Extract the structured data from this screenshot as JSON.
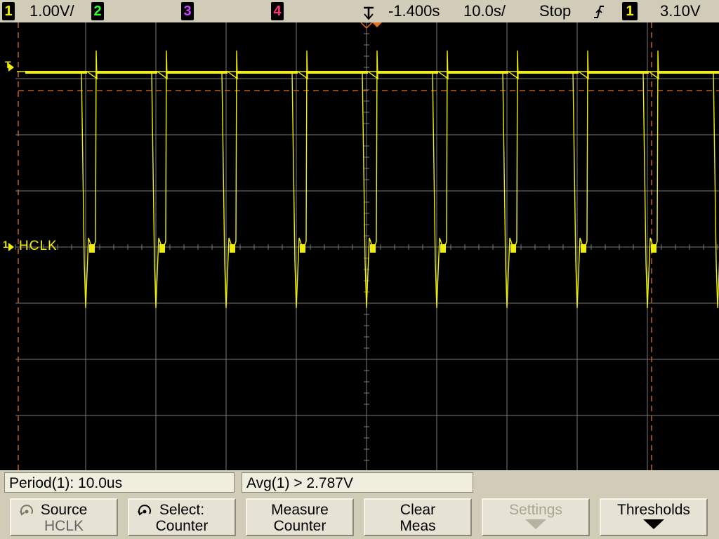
{
  "status_bar": {
    "ch1_label": "1",
    "ch1_scale": "1.00V/",
    "ch2_label": "2",
    "ch3_label": "3",
    "ch4_label": "4",
    "delay": "-1.400s",
    "timebase": "10.0s/",
    "run_state": "Stop",
    "trigger_slope_icon": "rising-edge-icon",
    "trigger_source": "1",
    "trigger_level": "3.10V",
    "colors": {
      "ch1": "#f5f500",
      "ch2": "#33ff33",
      "ch3": "#cc44ff",
      "ch4": "#ff3377"
    }
  },
  "screen": {
    "channel_marker": "1",
    "trigger_marker": "T",
    "channel_label": "HCLK",
    "trace_color": "#f0f000",
    "grid_color": "#7a7a7a",
    "cursor_color": "#e07020"
  },
  "measurements": {
    "period": "Period(1): 10.0us",
    "average": "Avg(1) > 2.787V"
  },
  "softkeys": [
    {
      "label": "Source",
      "sub": "HCLK",
      "icon": "rotary-knob-icon"
    },
    {
      "label": "Select:",
      "sub": "Counter",
      "icon": "rotary-knob-icon"
    },
    {
      "label": "Measure",
      "sub": "Counter"
    },
    {
      "label": "Clear",
      "sub": "Meas"
    },
    {
      "label": "Settings",
      "icon": "arrow-down-icon",
      "disabled": true
    },
    {
      "label": "Thresholds",
      "icon": "arrow-down-icon"
    }
  ]
}
